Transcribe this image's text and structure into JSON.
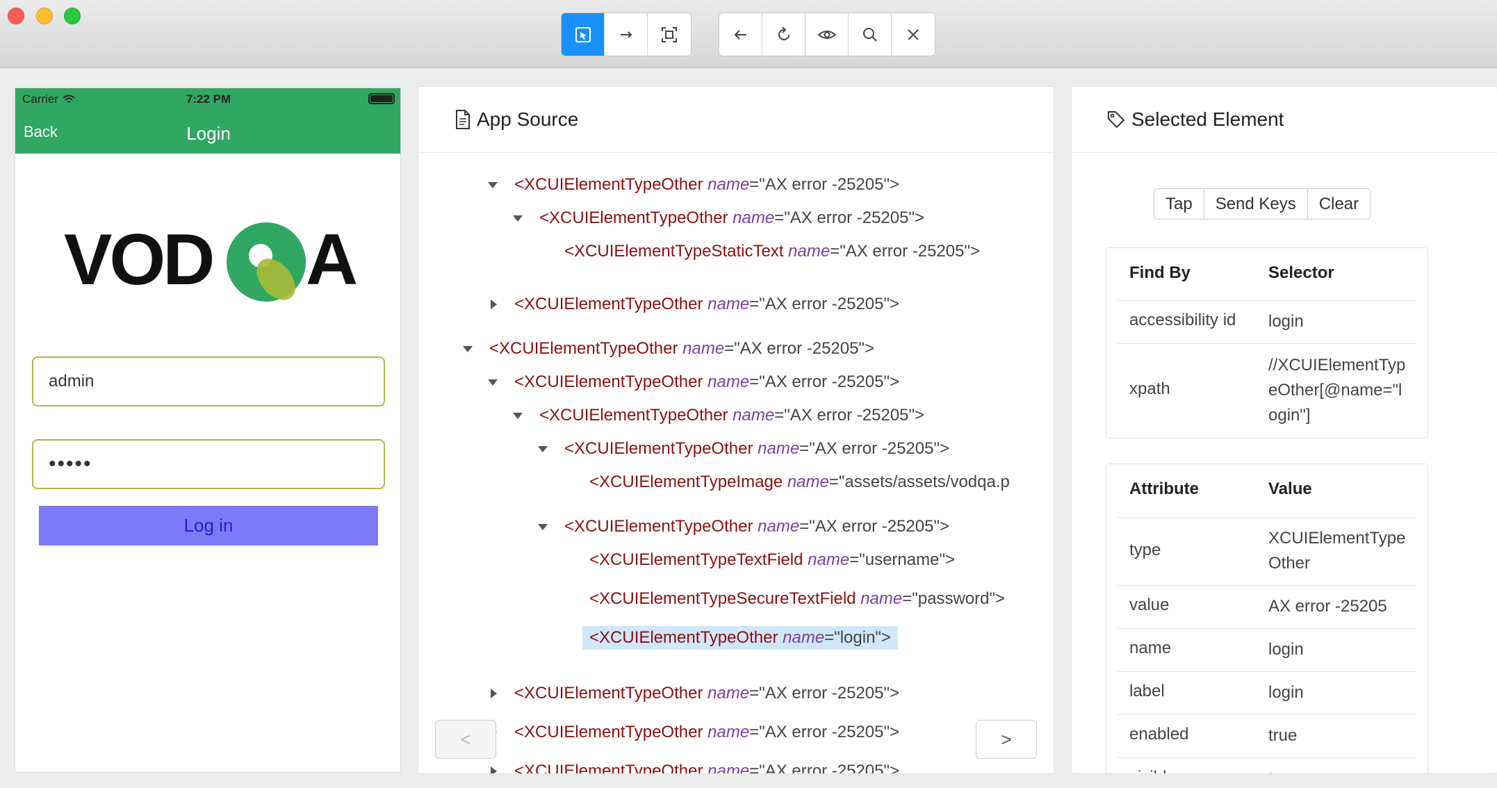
{
  "toolbar": {
    "group1": [
      {
        "icon": "select-element-icon",
        "active": true
      },
      {
        "icon": "swipe-arrow-icon",
        "active": false
      },
      {
        "icon": "tap-by-coordinates-icon",
        "active": false
      }
    ],
    "group2": [
      {
        "icon": "back-arrow-icon"
      },
      {
        "icon": "refresh-icon"
      },
      {
        "icon": "eye-icon"
      },
      {
        "icon": "search-icon"
      },
      {
        "icon": "close-icon"
      }
    ],
    "accent": "#1890ff"
  },
  "device": {
    "carrier": "Carrier",
    "time": "7:22 PM",
    "back_label": "Back",
    "nav_title": "Login",
    "logo_text": "VODQA",
    "username_value": "admin",
    "password_value": "•••••",
    "login_button": "Log in",
    "header_color": "#30a862"
  },
  "source": {
    "title": "App Source",
    "lines": [
      {
        "tag": "<XCUIElementTypeOther",
        "attr": "name",
        "val": "=\"AX error -25205\">",
        "caret": "down"
      },
      {
        "tag": "<XCUIElementTypeOther",
        "attr": "name",
        "val": "=\"AX error -25205\">",
        "caret": "down"
      },
      {
        "tag": "<XCUIElementTypeStaticText",
        "attr": "name",
        "val": "=\"AX error -25205\">",
        "caret": ""
      },
      {
        "tag": "<XCUIElementTypeOther",
        "attr": "name",
        "val": "=\"AX error -25205\">",
        "caret": "right"
      },
      {
        "tag": "<XCUIElementTypeOther",
        "attr": "name",
        "val": "=\"AX error -25205\">",
        "caret": "down"
      },
      {
        "tag": "<XCUIElementTypeOther",
        "attr": "name",
        "val": "=\"AX error -25205\">",
        "caret": "down"
      },
      {
        "tag": "<XCUIElementTypeOther",
        "attr": "name",
        "val": "=\"AX error -25205\">",
        "caret": "down"
      },
      {
        "tag": "<XCUIElementTypeOther",
        "attr": "name",
        "val": "=\"AX error -25205\">",
        "caret": "down"
      },
      {
        "tag": "<XCUIElementTypeImage",
        "attr": "name",
        "val": "=\"assets/assets/vodqa.p",
        "caret": ""
      },
      {
        "tag": "<XCUIElementTypeOther",
        "attr": "name",
        "val": "=\"AX error -25205\">",
        "caret": "down"
      },
      {
        "tag": "<XCUIElementTypeTextField",
        "attr": "name",
        "val": "=\"username\">",
        "caret": ""
      },
      {
        "tag": "<XCUIElementTypeSecureTextField",
        "attr": "name",
        "val": "=\"password\">",
        "caret": ""
      },
      {
        "tag": "<XCUIElementTypeOther",
        "attr": "name",
        "val": "=\"login\">",
        "caret": "",
        "selected": true
      },
      {
        "tag": "<XCUIElementTypeOther",
        "attr": "name",
        "val": "=\"AX error -25205\">",
        "caret": "right"
      },
      {
        "tag": "<XCUIElementTypeOther",
        "attr": "name",
        "val": "=\"AX error -25205\">",
        "caret": "right"
      },
      {
        "tag": "<XCUIElementTypeOther",
        "attr": "name",
        "val": "=\"AX error -25205\">",
        "caret": "right"
      }
    ],
    "prev": "<",
    "next": ">"
  },
  "selected": {
    "title": "Selected Element",
    "actions": [
      "Tap",
      "Send Keys",
      "Clear"
    ],
    "find_by": {
      "header": [
        "Find By",
        "Selector"
      ],
      "rows": [
        [
          "accessibility id",
          "login"
        ],
        [
          "xpath",
          "//XCUIElementTypeOther[@name=\"login\"]"
        ]
      ]
    },
    "attributes": {
      "header": [
        "Attribute",
        "Value"
      ],
      "rows": [
        [
          "type",
          "XCUIElementTypeOther"
        ],
        [
          "value",
          "AX error -25205"
        ],
        [
          "name",
          "login"
        ],
        [
          "label",
          "login"
        ],
        [
          "enabled",
          "true"
        ],
        [
          "visible",
          "true"
        ]
      ]
    }
  }
}
